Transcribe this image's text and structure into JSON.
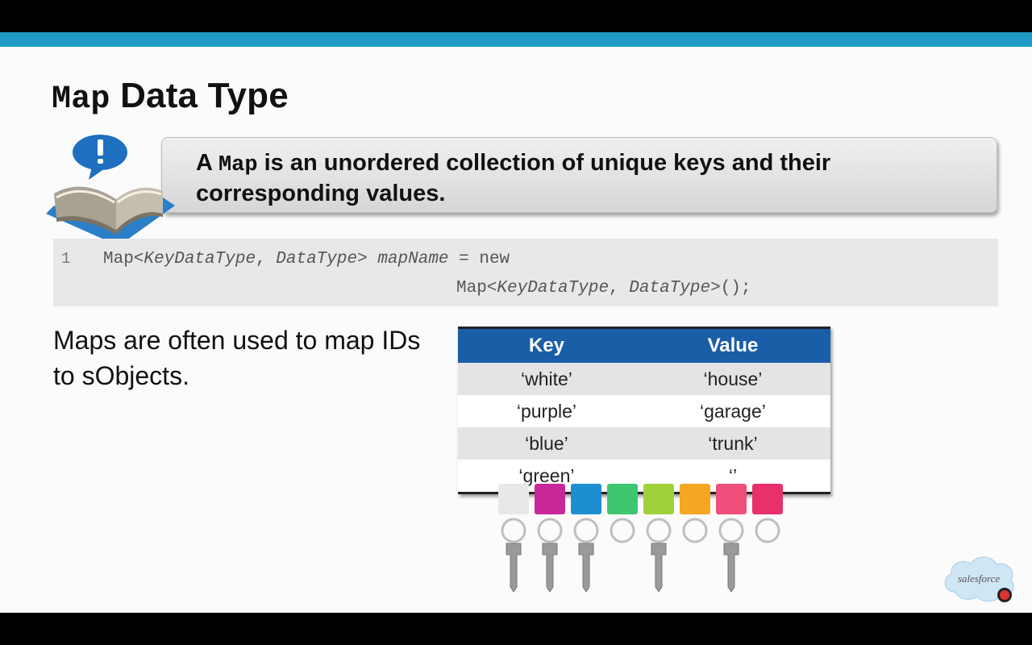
{
  "slide": {
    "title_code": "Map",
    "title_rest": "Data Type",
    "callout": {
      "prefix": "A",
      "code": "Map",
      "text": "is an unordered collection of unique keys and their corresponding values."
    },
    "code_block": {
      "line_number": "1",
      "line1": [
        "Map<",
        "KeyDataType",
        ", ",
        "DataType",
        "> ",
        "mapName",
        " = new"
      ],
      "line2": [
        "Map<",
        "KeyDataType",
        ", ",
        "DataType",
        ">();"
      ]
    },
    "body": "Maps are often used to map IDs to sObjects.",
    "table": {
      "headers": [
        "Key",
        "Value"
      ],
      "rows": [
        [
          "‘white’",
          "‘house’"
        ],
        [
          "‘purple’",
          "‘garage’"
        ],
        [
          "‘blue’",
          "‘trunk’"
        ],
        [
          "‘green’",
          "‘’"
        ]
      ]
    },
    "logo_text": "salesforce",
    "colors": {
      "accent_bar": "#1f9bc6",
      "table_header": "#1a5ea8"
    },
    "tag_colors": [
      "#e8e8e8",
      "#c8279a",
      "#1d8fd1",
      "#3ec66f",
      "#9fd23a",
      "#f5a623",
      "#ef4f7b",
      "#e8306a"
    ],
    "icons": [
      "book-icon",
      "alert-bubble-icon",
      "keys-image",
      "salesforce-logo"
    ]
  }
}
